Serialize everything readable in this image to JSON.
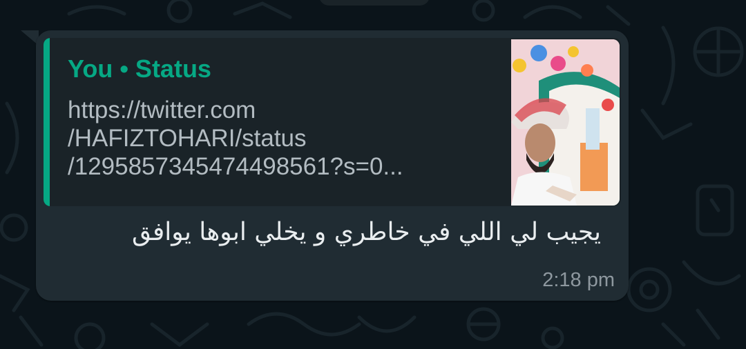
{
  "message": {
    "quoted": {
      "author": "You • Status",
      "link_lines": [
        "https://twitter.com",
        "/HAFIZTOHARI/status",
        "/1295857345474498561?s=0..."
      ],
      "thumbnail_icon": "status-photo-thumbnail"
    },
    "text": "يجيب لي اللي في خاطري و يخلي ابوها يوافق",
    "time": "2:18 pm"
  },
  "colors": {
    "background": "#0b141a",
    "bubble": "#202c33",
    "quote_background": "#1a2328",
    "accent": "#06a884",
    "text": "#e9edef",
    "secondary_text": "#b3bcc2",
    "timestamp": "#8e989f"
  }
}
